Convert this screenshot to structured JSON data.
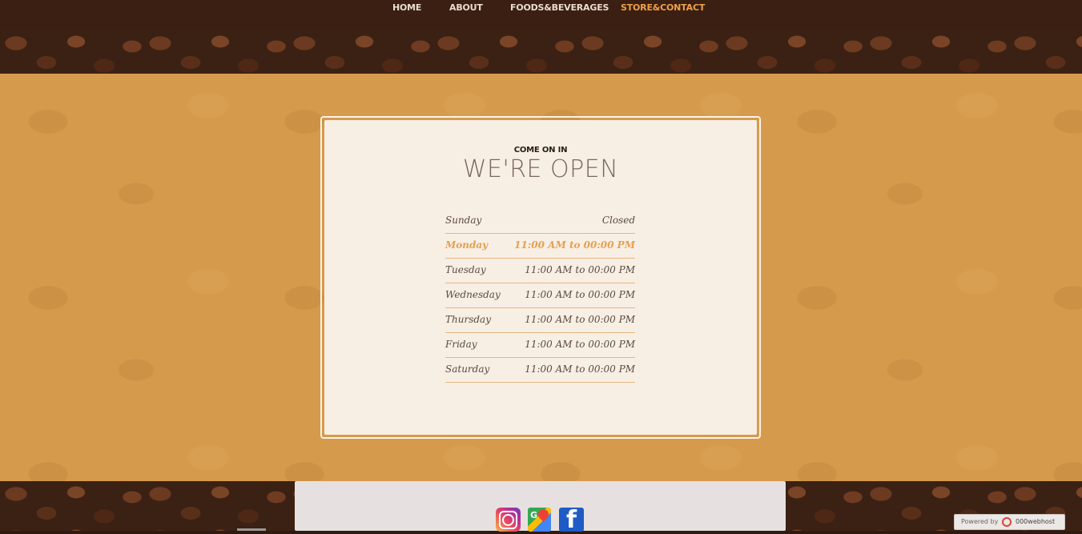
{
  "nav": {
    "items": [
      {
        "label": "HOME"
      },
      {
        "label": "ABOUT"
      },
      {
        "label": "FOODS&BEVERAGES"
      },
      {
        "label": "STORE&CONTACT",
        "active": true
      }
    ]
  },
  "hours_card": {
    "kicker": "COME ON IN",
    "title": "WE'RE OPEN",
    "rows": [
      {
        "day": "Sunday",
        "time": "Closed"
      },
      {
        "day": "Monday",
        "time": "11:00 AM to 00:00 PM",
        "today": true
      },
      {
        "day": "Tuesday",
        "time": "11:00 AM to 00:00 PM"
      },
      {
        "day": "Wednesday",
        "time": "11:00 AM to 00:00 PM"
      },
      {
        "day": "Thursday",
        "time": "11:00 AM to 00:00 PM"
      },
      {
        "day": "Friday",
        "time": "11:00 AM to 00:00 PM"
      },
      {
        "day": "Saturday",
        "time": "11:00 AM to 00:00 PM"
      }
    ]
  },
  "footer": {
    "social_icons": [
      "instagram-icon",
      "google-maps-icon",
      "facebook-icon"
    ],
    "maps_glyph": "G",
    "facebook_glyph": "f"
  },
  "badge": {
    "powered_by": "Powered by",
    "host": "000webhost"
  },
  "colors": {
    "nav_bg": "#3a1f12",
    "nav_active": "#f0a048",
    "main_bg": "#d69a4c",
    "card_bg": "#f8efe4",
    "row_divider": "#e8b681",
    "today_text": "#e7a050"
  }
}
